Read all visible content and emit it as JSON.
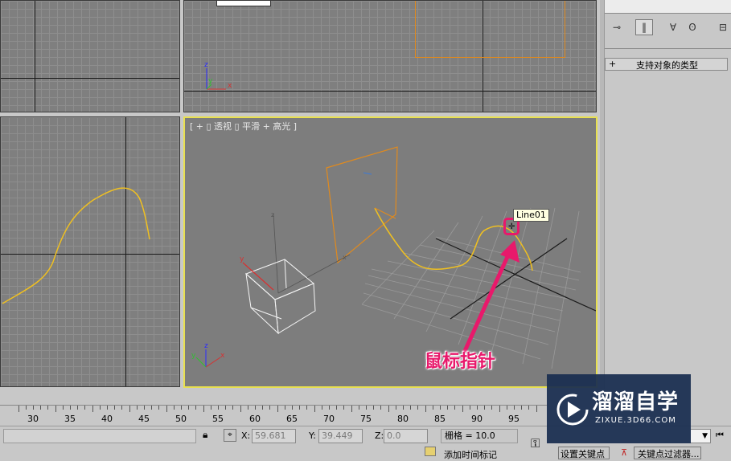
{
  "viewports": {
    "perspective_label": "[ + ▯ 透视 ▯ 平滑 + 高光 ]",
    "object_tooltip": "Line01",
    "axis_x": "x",
    "axis_y": "y",
    "axis_z": "z"
  },
  "command_panel": {
    "rollout_title": "支持对象的类型",
    "rollout_toggle": "+"
  },
  "timeline": {
    "ticks": [
      "30",
      "35",
      "40",
      "45",
      "50",
      "55",
      "60",
      "65",
      "70",
      "75",
      "80",
      "85",
      "90",
      "95"
    ]
  },
  "status_bar": {
    "x_label": "X:",
    "x_value": "59.681",
    "y_label": "Y:",
    "y_value": "39.449",
    "z_label": "Z:",
    "z_value": "0.0",
    "grid_text": "栅格 = 10.0",
    "add_time_tag": "添加时间标记",
    "set_key": "设置关键点",
    "key_filters": "关键点过滤器..."
  },
  "annotation": {
    "text": "鼠标指针"
  },
  "watermark": {
    "title": "溜溜自学",
    "subtitle": "ZIXUE.3D66.COM"
  },
  "colors": {
    "viewport_bg": "#7f7f7f",
    "active_border": "#e8e050",
    "spline": "#f0c020",
    "selected_orange": "#e08a1e",
    "annotation_pink": "#e8196b",
    "watermark_bg": "#192d50"
  }
}
